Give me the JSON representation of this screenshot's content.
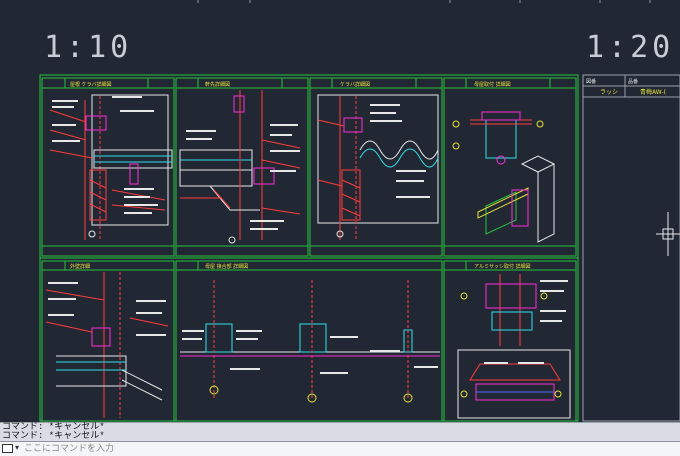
{
  "scales": {
    "left": "1:10",
    "right": "1:20"
  },
  "title_block": {
    "label1": "図番",
    "value1": "ラッシ",
    "label2": "品番",
    "value2": "青梅AW-("
  },
  "panels": [
    {
      "name": "panel-top-1",
      "title": "屋根 ケラバ詳細図"
    },
    {
      "name": "panel-top-2",
      "title": "軒先詳細図"
    },
    {
      "name": "panel-top-3",
      "title": "ケラバ詳細図"
    },
    {
      "name": "panel-top-4",
      "title": "母屋取付 詳細図"
    },
    {
      "name": "panel-bottom-1",
      "title": "外壁詳細"
    },
    {
      "name": "panel-bottom-2",
      "title": "母屋 接合部 詳細図"
    },
    {
      "name": "panel-bottom-3",
      "title": "アルミサッシ取付 詳細図"
    }
  ],
  "command": {
    "history": [
      "コマンド: *キャンセル*",
      "コマンド: *キャンセル*"
    ],
    "placeholder": "ここにコマンドを入力"
  },
  "colors": {
    "frame": "#27c23b",
    "red": "#ff3b3b",
    "magenta": "#ff2bd6",
    "cyan": "#2fe0e8",
    "white": "#e8e8e8",
    "blue": "#4a6cff",
    "yellow": "#e6e23a"
  }
}
